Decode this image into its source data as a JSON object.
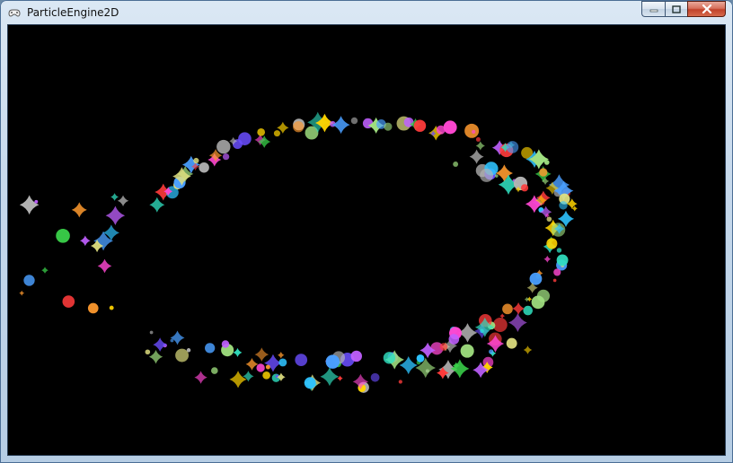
{
  "window": {
    "title": "ParticleEngine2D",
    "icons": {
      "app": "game-controller-icon",
      "minimize": "minimize-icon",
      "maximize": "maximize-icon",
      "close": "close-icon"
    }
  },
  "canvas": {
    "background": "#000000",
    "particle_shapes": [
      "circle",
      "star"
    ],
    "particle_palette": [
      "#ff3b3b",
      "#ffd400",
      "#3ad14a",
      "#2ec3ff",
      "#6a4dff",
      "#ff47d2",
      "#ff9a2e",
      "#b5b5b5",
      "#a0e080",
      "#c060ff",
      "#4a9fff",
      "#e0e080",
      "#30e0c0"
    ]
  }
}
